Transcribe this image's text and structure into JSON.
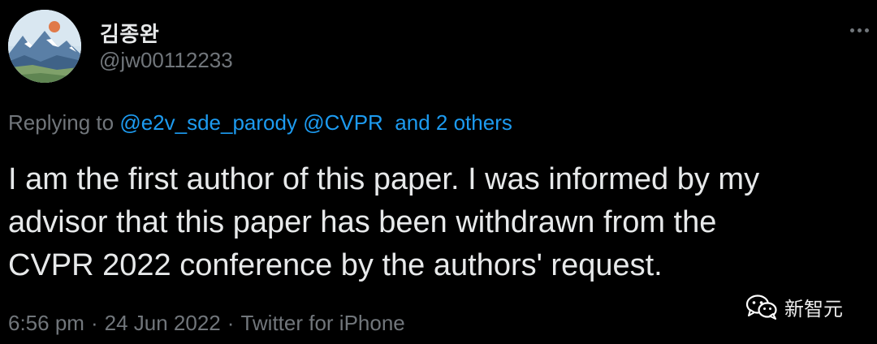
{
  "user": {
    "display_name": "김종완",
    "handle": "@jw00112233"
  },
  "header": {
    "more_icon": "more-horizontal-icon"
  },
  "reply": {
    "prefix": "Replying to",
    "mentions": [
      "@e2v_sde_parody",
      "@CVPR"
    ],
    "others": "and 2 others"
  },
  "tweet": {
    "lines": [
      "I am the first author of this paper. I was informed by my",
      "advisor that this paper has been withdrawn from the",
      "CVPR 2022 conference by the authors' request."
    ]
  },
  "meta": {
    "time": "6:56 pm",
    "separator": "·",
    "date": "24 Jun 2022",
    "source": "Twitter for iPhone"
  },
  "watermark": {
    "text": "新智元",
    "icon": "wechat-icon"
  },
  "colors": {
    "background": "#000000",
    "text": "#e7e9ea",
    "secondary": "#71767b",
    "link": "#1d9bf0"
  }
}
